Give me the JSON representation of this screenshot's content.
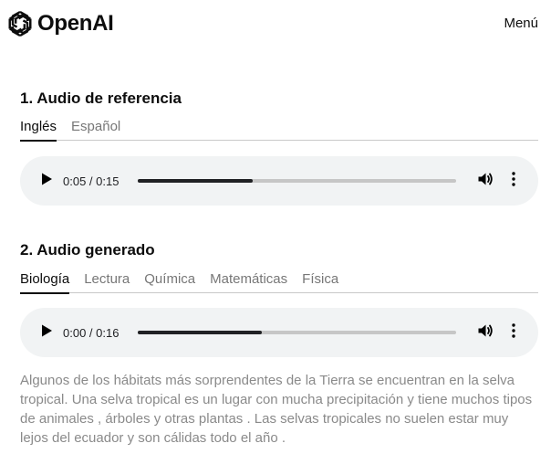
{
  "header": {
    "brand": "OpenAI",
    "menu_label": "Menú"
  },
  "reference": {
    "title": "1. Audio de referencia",
    "tabs": [
      {
        "label": "Inglés",
        "active": true
      },
      {
        "label": "Español",
        "active": false
      }
    ],
    "player": {
      "time": "0:05 / 0:15",
      "progress": 0.36
    }
  },
  "generated": {
    "title": "2. Audio generado",
    "tabs": [
      {
        "label": "Biología",
        "active": true
      },
      {
        "label": "Lectura",
        "active": false
      },
      {
        "label": "Química",
        "active": false
      },
      {
        "label": "Matemáticas",
        "active": false
      },
      {
        "label": "Física",
        "active": false
      }
    ],
    "player": {
      "time": "0:00 / 0:16",
      "progress": 0.39
    }
  },
  "transcript": "Algunos de los hábitats más sorprendentes de la Tierra se encuentran en la selva tropical. Una selva tropical es un lugar con mucha precipitación y tiene muchos tipos de animales , árboles y otras plantas . Las selvas tropicales no suelen estar muy lejos del ecuador y son cálidas todo el año .",
  "icons": {
    "logo": "openai-logo-icon",
    "play": "play-icon",
    "volume": "volume-icon",
    "more": "more-vertical-icon"
  },
  "colors": {
    "text": "#0d0d0d",
    "muted": "#777777",
    "player_bg": "#f1f3f4",
    "transcript": "#8a8a8a"
  }
}
